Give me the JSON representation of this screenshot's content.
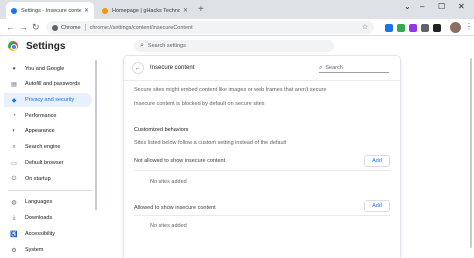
{
  "browser": {
    "tabs": [
      {
        "title": "Settings - Insecure content",
        "active": true,
        "favicon_color": "#1a73e8"
      },
      {
        "title": "Homepage | gHacks Technology",
        "active": false,
        "favicon_color": "#f29900"
      }
    ],
    "new_tab_label": "+",
    "window_controls": {
      "dropdown": "⌄",
      "minimize": "–",
      "maximize": "☐",
      "close": "✕"
    },
    "site_label": "Chrome",
    "url": "chrome://settings/content/insecureContent",
    "ext_colors": [
      "#1a73e8",
      "#34a853",
      "#9334e6",
      "#5f6368",
      "#202124",
      "#1a73e8"
    ]
  },
  "settings": {
    "title": "Settings",
    "search_placeholder": "Search settings"
  },
  "sidebar": {
    "items": [
      {
        "label": "You and Google",
        "icon": "person-icon",
        "glyph": "●"
      },
      {
        "label": "Autofill and passwords",
        "icon": "autofill-icon",
        "glyph": "▤"
      },
      {
        "label": "Privacy and security",
        "icon": "shield-icon",
        "glyph": "◆",
        "active": true
      },
      {
        "label": "Performance",
        "icon": "performance-icon",
        "glyph": "◔"
      },
      {
        "label": "Appearance",
        "icon": "palette-icon",
        "glyph": "◐"
      },
      {
        "label": "Search engine",
        "icon": "search-icon",
        "glyph": "⌕"
      },
      {
        "label": "Default browser",
        "icon": "browser-icon",
        "glyph": "▭"
      },
      {
        "label": "On startup",
        "icon": "power-icon",
        "glyph": "⏻"
      },
      {
        "label": "Languages",
        "icon": "globe-icon",
        "glyph": "◍"
      },
      {
        "label": "Downloads",
        "icon": "download-icon",
        "glyph": "⤓"
      },
      {
        "label": "Accessibility",
        "icon": "accessibility-icon",
        "glyph": "♿"
      },
      {
        "label": "System",
        "icon": "wrench-icon",
        "glyph": "⚙"
      }
    ]
  },
  "content": {
    "title": "Insecure content",
    "search_placeholder": "Search",
    "description1": "Secure sites might embed content like images or web frames that aren't secure",
    "description2": "Insecure content is blocked by default on secure sites",
    "custom_heading": "Customized behaviors",
    "custom_sub": "Sites listed below follow a custom setting instead of the default",
    "not_allowed_label": "Not allowed to show insecure content",
    "not_allowed_empty": "No sites added",
    "allowed_label": "Allowed to show insecure content",
    "allowed_empty": "No sites added",
    "add_label": "Add"
  }
}
